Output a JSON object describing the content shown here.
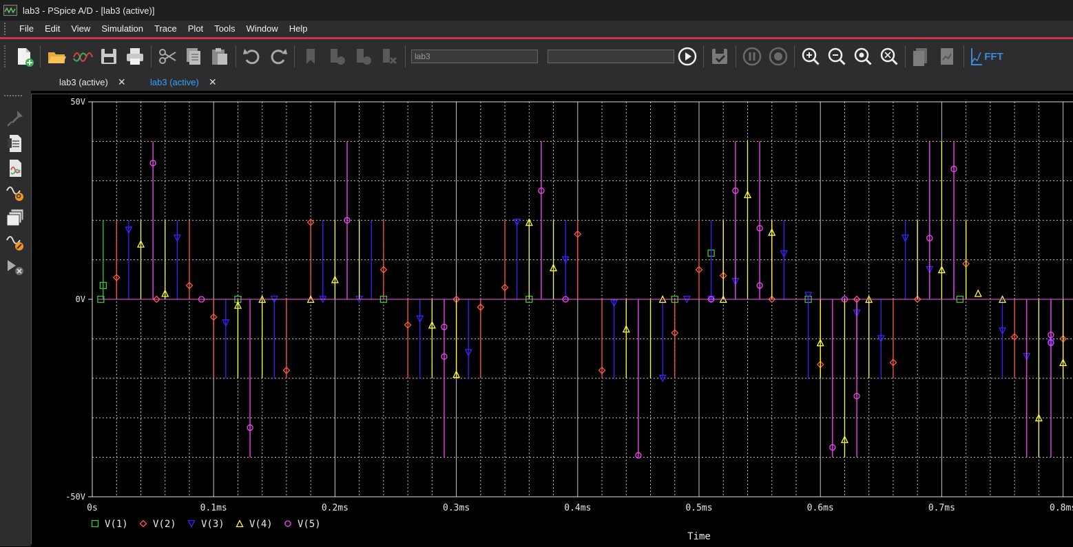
{
  "window": {
    "title": "lab3 - PSpice A/D  - [lab3 (active)]"
  },
  "menu": [
    "File",
    "Edit",
    "View",
    "Simulation",
    "Trace",
    "Plot",
    "Tools",
    "Window",
    "Help"
  ],
  "toolbar": {
    "profile_value": "lab3",
    "profile_placeholder": "lab3",
    "fft_label": "FFT",
    "icons": [
      "new-file-icon",
      "open-folder-icon",
      "waveform-icon",
      "save-icon",
      "print-icon",
      "cut-icon",
      "copy-icon",
      "paste-icon",
      "undo-icon",
      "redo-icon",
      "bookmark-icon",
      "run-icon",
      "stop-icon",
      "clear-icon",
      "run-play-icon",
      "save-check-icon",
      "pause-icon",
      "stop-circle-icon",
      "zoom-in-icon",
      "zoom-out-icon",
      "zoom-area-icon",
      "zoom-fit-icon",
      "add-plot-icon",
      "add-y-axis-icon",
      "fft-icon"
    ]
  },
  "tabs": [
    {
      "label": "lab3 (active)",
      "active": false
    },
    {
      "label": "lab3 (active)",
      "active": true
    }
  ],
  "sidebar": {
    "icons": [
      "marker-icon",
      "pspice-doc-icon",
      "waveform-doc-icon",
      "trace-search-icon",
      "multi-window-icon",
      "trace-edit-icon",
      "trace-delete-icon"
    ]
  },
  "colors": {
    "accent": "#d1343f",
    "tab_active": "#33a3ff",
    "v1": "#33cc33",
    "v2": "#ff5a3c",
    "v3": "#3a22ff",
    "v4": "#ffff33",
    "v5": "#ff44ff",
    "grid": "#c8c8c8"
  },
  "chart_data": {
    "type": "line",
    "xlabel": "Time",
    "ylabel": "",
    "x_unit": "ms",
    "xlim": [
      0,
      0.8
    ],
    "ylim": [
      -50,
      50
    ],
    "y_ticks": [
      "50V",
      "0V",
      "-50V"
    ],
    "x_ticks": [
      "0s",
      "0.1ms",
      "0.2ms",
      "0.3ms",
      "0.4ms",
      "0.5ms",
      "0.6ms",
      "0.7ms",
      "0.8ms"
    ],
    "grid": true,
    "legend_position": "bottom-left",
    "series": [
      {
        "name": "V(1)",
        "color": "#33cc33",
        "marker": "square",
        "x": [
          0.007,
          0.009,
          0.12,
          0.24,
          0.36,
          0.48,
          0.51,
          0.59,
          0.715
        ],
        "y": [
          0,
          3.5,
          0,
          0,
          0,
          0,
          11.7,
          0,
          0
        ],
        "spans": [
          [
            0.009,
            20
          ],
          [
            0.12,
            -20
          ]
        ]
      },
      {
        "name": "V(2)",
        "color": "#ff5a3c",
        "marker": "diamond",
        "x": [
          0.02,
          0.053,
          0.08,
          0.1,
          0.16,
          0.18,
          0.24,
          0.26,
          0.3,
          0.32,
          0.34,
          0.4,
          0.42,
          0.48,
          0.5,
          0.52,
          0.56,
          0.6,
          0.63,
          0.66,
          0.68,
          0.72,
          0.76,
          0.8
        ],
        "y": [
          5.5,
          0,
          3.5,
          -4.5,
          -18,
          19.5,
          7.5,
          -6.5,
          0,
          -2,
          3,
          16.5,
          -18,
          -8.5,
          7.5,
          6,
          0,
          -16.5,
          0,
          -16,
          0,
          9,
          -9.5,
          -10
        ],
        "spans": [
          [
            0.02,
            20
          ],
          [
            0.08,
            20
          ],
          [
            0.1,
            -20
          ],
          [
            0.16,
            -20
          ],
          [
            0.18,
            20
          ],
          [
            0.24,
            20
          ],
          [
            0.26,
            -20
          ],
          [
            0.3,
            -20
          ],
          [
            0.32,
            -20
          ],
          [
            0.34,
            20
          ],
          [
            0.4,
            20
          ],
          [
            0.42,
            -20
          ],
          [
            0.48,
            -20
          ],
          [
            0.5,
            20
          ],
          [
            0.52,
            20
          ],
          [
            0.56,
            20
          ],
          [
            0.6,
            -20
          ],
          [
            0.63,
            -20
          ],
          [
            0.66,
            -20
          ],
          [
            0.68,
            20
          ],
          [
            0.72,
            20
          ],
          [
            0.76,
            -20
          ],
          [
            0.8,
            -20
          ]
        ]
      },
      {
        "name": "V(3)",
        "color": "#3a22ff",
        "marker": "triangle-down",
        "x": [
          0.03,
          0.07,
          0.11,
          0.15,
          0.19,
          0.22,
          0.27,
          0.31,
          0.35,
          0.39,
          0.43,
          0.47,
          0.49,
          0.51,
          0.53,
          0.57,
          0.59,
          0.63,
          0.65,
          0.67,
          0.69,
          0.75,
          0.77,
          0.79
        ],
        "y": [
          17.5,
          15.5,
          -6,
          0,
          0,
          0,
          -5,
          -13.5,
          19.5,
          10,
          -1,
          -20,
          0,
          0,
          4.5,
          11.5,
          1,
          -3.5,
          -10,
          15.5,
          7.5,
          -8,
          -14.5,
          -11
        ],
        "spans": [
          [
            0.03,
            20
          ],
          [
            0.07,
            20
          ],
          [
            0.11,
            -20
          ],
          [
            0.15,
            -20
          ],
          [
            0.19,
            20
          ],
          [
            0.23,
            20
          ],
          [
            0.27,
            -20
          ],
          [
            0.31,
            -20
          ],
          [
            0.35,
            20
          ],
          [
            0.39,
            20
          ],
          [
            0.43,
            -20
          ],
          [
            0.47,
            -20
          ],
          [
            0.51,
            20
          ],
          [
            0.53,
            20
          ],
          [
            0.57,
            20
          ],
          [
            0.59,
            -20
          ],
          [
            0.63,
            -20
          ],
          [
            0.65,
            -20
          ],
          [
            0.67,
            20
          ],
          [
            0.71,
            20
          ],
          [
            0.75,
            -20
          ],
          [
            0.79,
            -20
          ]
        ]
      },
      {
        "name": "V(4)",
        "color": "#ffff33",
        "marker": "triangle-up",
        "x": [
          0.04,
          0.06,
          0.12,
          0.14,
          0.18,
          0.2,
          0.28,
          0.3,
          0.36,
          0.38,
          0.44,
          0.47,
          0.52,
          0.54,
          0.56,
          0.6,
          0.62,
          0.64,
          0.7,
          0.73,
          0.75,
          0.78,
          0.8
        ],
        "y": [
          14,
          1.5,
          -1.5,
          0,
          0,
          5,
          -6.5,
          -19,
          19.5,
          8,
          -7.5,
          0,
          0,
          26.5,
          17,
          -11,
          -35.5,
          0,
          7.5,
          1.5,
          0,
          -30,
          -16
        ],
        "spans": [
          [
            0.04,
            20
          ],
          [
            0.06,
            20
          ],
          [
            0.12,
            -20
          ],
          [
            0.14,
            -20
          ],
          [
            0.2,
            20
          ],
          [
            0.22,
            20
          ],
          [
            0.28,
            -20
          ],
          [
            0.3,
            -20
          ],
          [
            0.36,
            20
          ],
          [
            0.38,
            20
          ],
          [
            0.44,
            -20
          ],
          [
            0.46,
            -20
          ],
          [
            0.52,
            20
          ],
          [
            0.54,
            40
          ],
          [
            0.56,
            20
          ],
          [
            0.6,
            -20
          ],
          [
            0.62,
            -40
          ],
          [
            0.64,
            -20
          ],
          [
            0.68,
            20
          ],
          [
            0.7,
            40
          ],
          [
            0.72,
            20
          ],
          [
            0.78,
            -40
          ],
          [
            0.8,
            -20
          ]
        ]
      },
      {
        "name": "V(5)",
        "color": "#ff44ff",
        "marker": "circle",
        "x": [
          0.05,
          0.09,
          0.13,
          0.21,
          0.29,
          0.29,
          0.37,
          0.39,
          0.45,
          0.51,
          0.53,
          0.55,
          0.55,
          0.61,
          0.62,
          0.63,
          0.69,
          0.71,
          0.79,
          0.79
        ],
        "y": [
          34.5,
          0,
          -32.5,
          20,
          -7,
          -14.5,
          27.5,
          0,
          -39.5,
          0,
          27.5,
          18,
          3.5,
          -37.5,
          0,
          -24.5,
          15.5,
          33,
          -9,
          -11
        ],
        "spans": [
          [
            0.05,
            40
          ],
          [
            0.13,
            -40
          ],
          [
            0.21,
            40
          ],
          [
            0.29,
            -40
          ],
          [
            0.37,
            40
          ],
          [
            0.45,
            -40
          ],
          [
            0.53,
            40
          ],
          [
            0.55,
            40
          ],
          [
            0.61,
            -40
          ],
          [
            0.63,
            -40
          ],
          [
            0.69,
            40
          ],
          [
            0.71,
            40
          ],
          [
            0.77,
            -40
          ],
          [
            0.79,
            -40
          ]
        ]
      }
    ]
  }
}
